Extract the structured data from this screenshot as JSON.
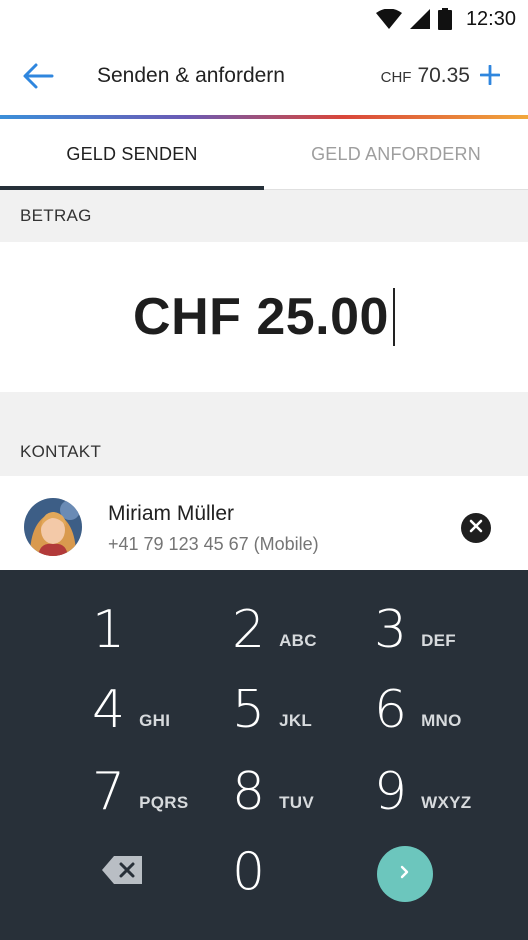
{
  "status_bar": {
    "time": "12:30",
    "icons": [
      "wifi-icon",
      "signal-icon",
      "battery-icon"
    ]
  },
  "app_bar": {
    "back_icon": "arrow-left-icon",
    "title": "Senden & anfordern",
    "balance_currency": "CHF",
    "balance_amount": "70.35",
    "add_icon": "plus-icon"
  },
  "tabs": [
    {
      "label": "GELD SENDEN",
      "active": true
    },
    {
      "label": "GELD ANFORDERN",
      "active": false
    }
  ],
  "amount_section": {
    "header": "BETRAG",
    "value": "CHF 25.00"
  },
  "contact_section": {
    "header": "KONTAKT",
    "name": "Miriam Müller",
    "phone": "+41 79 123 45 67 (Mobile)",
    "remove_icon": "close-circle-icon"
  },
  "keypad": {
    "keys": [
      {
        "digit": "1",
        "letters": ""
      },
      {
        "digit": "2",
        "letters": "ABC"
      },
      {
        "digit": "3",
        "letters": "DEF"
      },
      {
        "digit": "4",
        "letters": "GHI"
      },
      {
        "digit": "5",
        "letters": "JKL"
      },
      {
        "digit": "6",
        "letters": "MNO"
      },
      {
        "digit": "7",
        "letters": "PQRS"
      },
      {
        "digit": "8",
        "letters": "TUV"
      },
      {
        "digit": "9",
        "letters": "WXYZ"
      },
      {
        "digit": "0",
        "letters": ""
      }
    ],
    "backspace_icon": "backspace-icon",
    "next_icon": "chevron-right-icon"
  },
  "colors": {
    "accent_blue": "#2f86de",
    "keypad_background": "#283039",
    "next_button": "#6cc6bd",
    "active_tab_indicator": "#263039"
  }
}
